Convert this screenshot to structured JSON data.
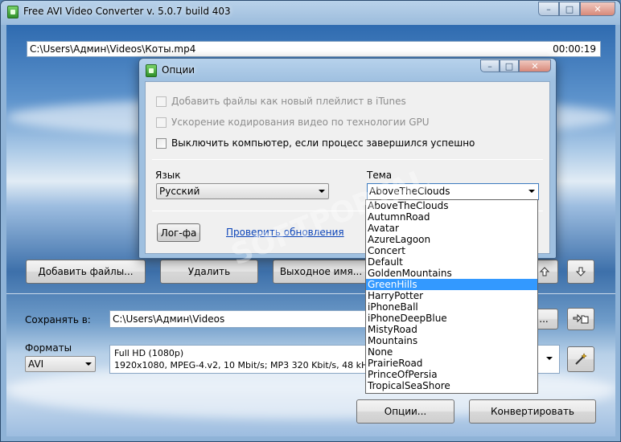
{
  "window": {
    "title": "Free AVI Video Converter  v. 5.0.7 build 403",
    "minimize": "–",
    "maximize": "□",
    "close": "✕"
  },
  "file": {
    "path": "C:\\Users\\Админ\\Videos\\Коты.mp4",
    "duration": "00:00:19"
  },
  "toolbar": {
    "add_files": "Добавить файлы...",
    "remove": "Удалить",
    "output_name": "Выходное имя...",
    "up_icon": "arrow-up-icon",
    "down_icon": "arrow-down-icon"
  },
  "save": {
    "label": "Сохранять в:",
    "path": "C:\\Users\\Админ\\Videos",
    "browse": "...",
    "open_folder_icon": "open-folder-icon"
  },
  "formats": {
    "label": "Форматы",
    "selected": "AVI",
    "preset_line1": "Full HD (1080p)",
    "preset_line2": "1920x1080, MPEG-4.v2, 10 Mbit/s; MP3 320 Kbit/s, 48 kHz",
    "wizard_icon": "magic-wand-icon"
  },
  "actions": {
    "options": "Опции...",
    "convert": "Конвертировать"
  },
  "dialog": {
    "title": "Опции",
    "options": [
      {
        "label": "Добавить файлы как новый плейлист в iTunes",
        "enabled": false,
        "checked": false
      },
      {
        "label": "Ускорение кодирования видео по технологии GPU",
        "enabled": false,
        "checked": false
      },
      {
        "label": "Выключить компьютер, если процесс завершился успешно",
        "enabled": true,
        "checked": false
      }
    ],
    "language_label": "Язык",
    "language_value": "Русский",
    "theme_label": "Тема",
    "theme_value": "AboveTheClouds",
    "log_button": "Лог-фа",
    "check_updates": "Проверить обновления"
  },
  "theme_dropdown": {
    "options": [
      "AboveTheClouds",
      "AutumnRoad",
      "Avatar",
      "AzureLagoon",
      "Concert",
      "Default",
      "GoldenMountains",
      "GreenHills",
      "HarryPotter",
      "iPhoneBall",
      "iPhoneDeepBlue",
      "MistyRoad",
      "Mountains",
      "None",
      "PrairieRoad",
      "PrinceOfPersia",
      "TropicalSeaShore"
    ],
    "highlighted": "GreenHills"
  },
  "watermark": "SOFTPORTAL"
}
